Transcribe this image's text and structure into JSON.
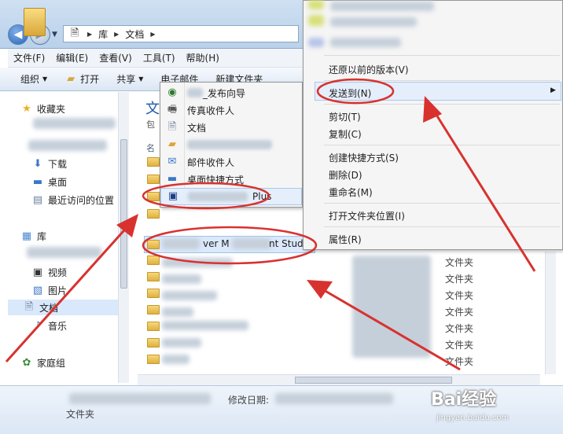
{
  "address": {
    "crumbs": [
      "库",
      "文档"
    ]
  },
  "menubar": [
    "文件(F)",
    "编辑(E)",
    "查看(V)",
    "工具(T)",
    "帮助(H)"
  ],
  "toolbar": {
    "organize": "组织",
    "open": "打开",
    "share": "共享",
    "email": "电子邮件",
    "new_folder": "新建文件夹"
  },
  "navpane": {
    "favorites": "收藏夹",
    "downloads": "下载",
    "desktop": "桌面",
    "recent": "最近访问的位置",
    "libraries": "库",
    "videos": "视频",
    "pictures": "图片",
    "documents": "文档",
    "music": "音乐",
    "homegroup": "家庭组"
  },
  "filelist": {
    "title_partial": "文",
    "subtitle_partial": "包",
    "col_name_partial": "名",
    "selected_row_partial_a": "ver M",
    "selected_row_partial_b": "nt Studi",
    "type_label": "文件夹"
  },
  "sendto_menu": {
    "items": [
      "_发布向导",
      "传真收件人",
      "文档",
      "邮件收件人",
      "桌面快捷方式",
      "Plus"
    ]
  },
  "context_menu": {
    "restore": "还原以前的版本(V)",
    "send_to": "发送到(N)",
    "cut": "剪切(T)",
    "copy": "复制(C)",
    "create_shortcut": "创建快捷方式(S)",
    "delete": "删除(D)",
    "rename": "重命名(M)",
    "open_location": "打开文件夹位置(I)",
    "properties": "属性(R)"
  },
  "details": {
    "modified_label": "修改日期:",
    "type": "文件夹"
  },
  "watermark": {
    "main": "Bai经验",
    "sub": "jingyan.baidu.com"
  }
}
